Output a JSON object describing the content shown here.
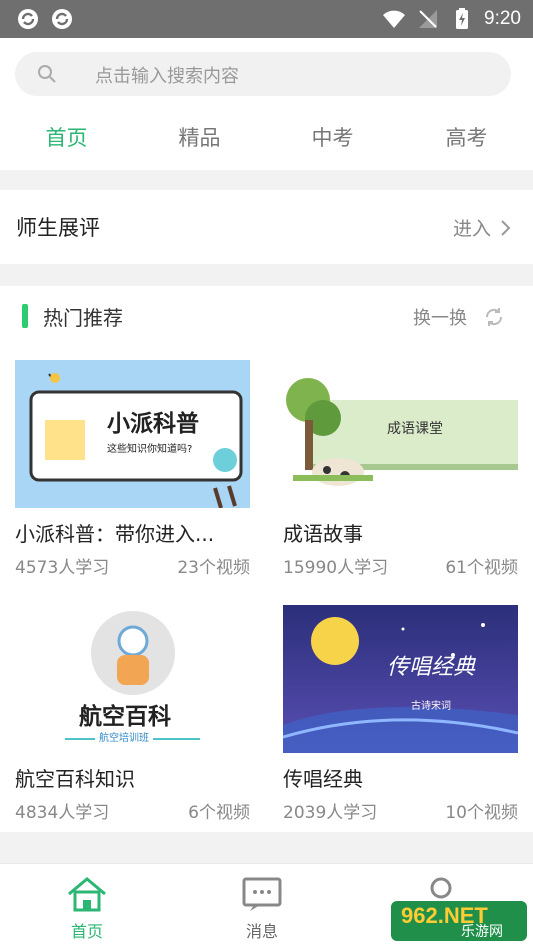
{
  "status_bar": {
    "time": "9:20"
  },
  "search": {
    "placeholder": "点击输入搜索内容"
  },
  "tabs": [
    "首页",
    "精品",
    "中考",
    "高考"
  ],
  "teachers_row": {
    "title": "师生展评",
    "enter_label": "进入"
  },
  "hot": {
    "title": "热门推荐",
    "swap_label": "换一换",
    "cards": [
      {
        "title": "小派科普：带你进入...",
        "learners": "4573人学习",
        "videos": "23个视频",
        "thumb_title": "小派科普",
        "thumb_sub": "这些知识你知道吗?"
      },
      {
        "title": "成语故事",
        "learners": "15990人学习",
        "videos": "61个视频",
        "thumb_title": "成语课堂"
      },
      {
        "title": "航空百科知识",
        "learners": "4834人学习",
        "videos": "6个视频",
        "thumb_title": "航空百科",
        "thumb_sub": "航空培训班"
      },
      {
        "title": "传唱经典",
        "learners": "2039人学习",
        "videos": "10个视频",
        "thumb_title": "传唱经典",
        "thumb_sub": "古诗宋词"
      }
    ]
  },
  "bottom_nav": [
    {
      "label": "首页",
      "icon": "home-icon"
    },
    {
      "label": "消息",
      "icon": "message-icon"
    },
    {
      "label": "",
      "icon": "user-icon"
    }
  ],
  "watermark": {
    "main": "962.NET",
    "sub": "乐游网"
  },
  "colors": {
    "accent": "#2bb673",
    "status_bar": "#6f6f6f"
  }
}
